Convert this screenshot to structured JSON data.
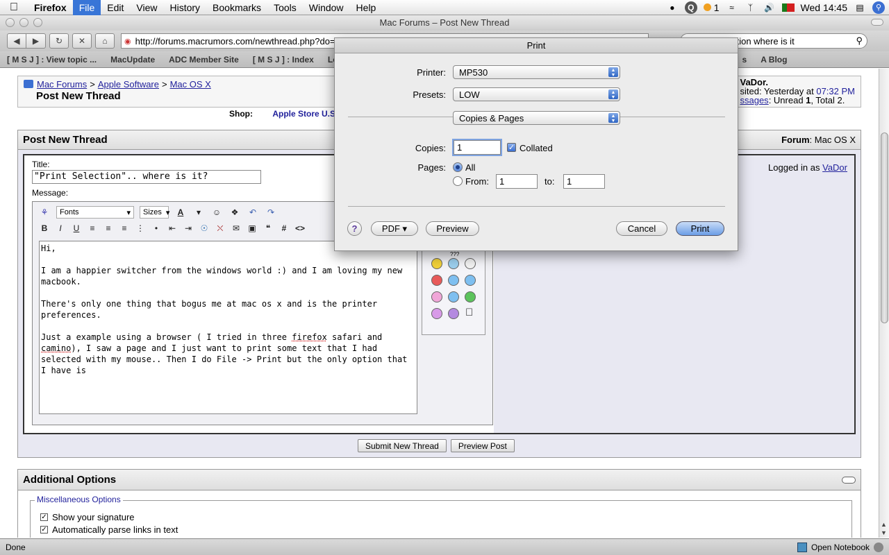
{
  "menubar": {
    "app_name": "Firefox",
    "items": [
      "File",
      "Edit",
      "View",
      "History",
      "Bookmarks",
      "Tools",
      "Window",
      "Help"
    ],
    "active_item": "File",
    "tray_badge": "1",
    "clock": "Wed 14:45"
  },
  "window": {
    "title": "Mac Forums – Post New Thread"
  },
  "toolbar": {
    "url": "http://forums.macrumors.com/newthread.php?do=newthread&f=62",
    "search_value": "print selection where is it"
  },
  "bookmarks": [
    "[ M S J ] : View topic ...",
    "MacUpdate",
    "ADC Member Site",
    "[ M S J ] : Index",
    "Lorem",
    "s",
    "A Blog"
  ],
  "page": {
    "breadcrumb": [
      "Mac Forums",
      "Apple Software",
      "Mac OS X"
    ],
    "breadcrumb_sep": ">",
    "title": "Post New Thread",
    "user": {
      "line1": "VaDor.",
      "line2_prefix": "sited: Yesterday at ",
      "line2_time": "07:32 PM",
      "line3_link": "ssages",
      "line3_rest_prefix": ": Unread ",
      "unread": "1",
      "line3_total_prefix": ", Total ",
      "total": "2."
    },
    "shop_label": "Shop:",
    "shop_link": "Apple Store U.S.",
    "post_box": {
      "heading": "Post New Thread",
      "forum_label": "Forum",
      "forum_value": ": Mac OS X",
      "logged_in_prefix": "Logged in as ",
      "logged_in_user": "VaDor",
      "title_label": "Title:",
      "title_value": "\"Print Selection\".. where is it?",
      "message_label": "Message:",
      "fonts_select": "Fonts",
      "sizes_select": "Sizes",
      "message_paragraphs": [
        "Hi,",
        "I am a happier switcher from the windows world :) and I am loving my new macbook.",
        "There's only one thing that bogus me at mac os x and is the printer preferences."
      ],
      "message_last_prefix": "Just a example using a browser ( I tried in three ",
      "message_word_firefox": "firefox",
      "message_mid": " safari and ",
      "message_word_camino": "camino",
      "message_last_suffix": "), I saw a page and I just want to print some text that I had selected with my mouse.. Then I do  File -> Print  but the only option that I have is",
      "smilies_hint": "???"
    },
    "submit_button": "Submit New Thread",
    "preview_button": "Preview Post",
    "additional": {
      "heading": "Additional Options",
      "misc_legend": "Miscellaneous Options",
      "opt_signature": "Show your signature",
      "opt_links": "Automatically parse links in text"
    }
  },
  "statusbar": {
    "left": "Done",
    "right": "Open Notebook"
  },
  "print_sheet": {
    "title": "Print",
    "printer_label": "Printer:",
    "printer_value": "MP530",
    "presets_label": "Presets:",
    "presets_value": "LOW",
    "pane_value": "Copies & Pages",
    "copies_label": "Copies:",
    "copies_value": "1",
    "collated_label": "Collated",
    "pages_label": "Pages:",
    "all_label": "All",
    "from_label": "From:",
    "from_value": "1",
    "to_label": "to:",
    "to_value": "1",
    "help_glyph": "?",
    "pdf_button": "PDF ▾",
    "preview_button": "Preview",
    "cancel_button": "Cancel",
    "print_button": "Print"
  }
}
